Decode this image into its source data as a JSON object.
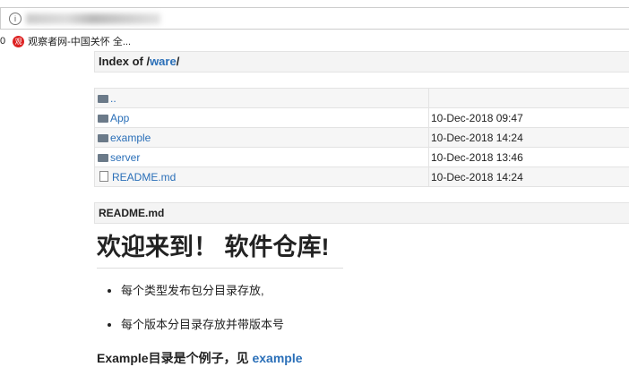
{
  "browser": {
    "info_icon": "i",
    "bookmark_count": "0",
    "bookmark_logo": "观",
    "bookmark_label": "观察者网-中国关怀 全..."
  },
  "index": {
    "prefix": "Index of /",
    "dir": "ware",
    "suffix": "/"
  },
  "rows": [
    {
      "name": "..",
      "date": "",
      "type": "folder"
    },
    {
      "name": "App",
      "date": "10-Dec-2018 09:47",
      "type": "folder"
    },
    {
      "name": "example",
      "date": "10-Dec-2018 14:24",
      "type": "folder"
    },
    {
      "name": "server",
      "date": "10-Dec-2018 13:46",
      "type": "folder"
    },
    {
      "name": "README.md",
      "date": "10-Dec-2018 14:24",
      "type": "file"
    }
  ],
  "readme": {
    "header": "README.md",
    "h1": "欢迎来到！ 软件仓库!",
    "bullets": [
      "每个类型发布包分目录存放,",
      "每个版本分目录存放并带版本号"
    ],
    "h3_text": "Example目录是个例子，见 ",
    "h3_link": "example"
  }
}
